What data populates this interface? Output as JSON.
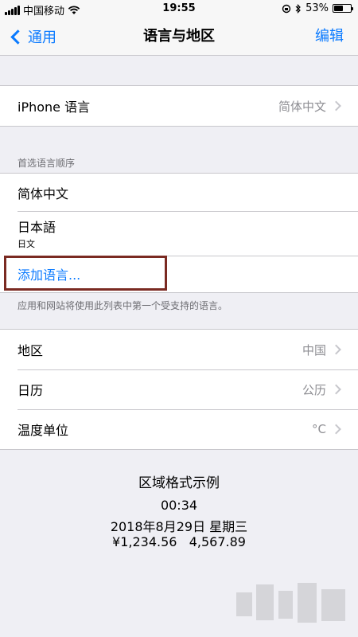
{
  "status": {
    "carrier": "中国移动",
    "time": "19:55",
    "battery_percent": "53%",
    "battery_level": 0.53
  },
  "nav": {
    "back_label": "通用",
    "title": "语言与地区",
    "edit_label": "编辑"
  },
  "iphone_language": {
    "label": "iPhone 语言",
    "value": "简体中文"
  },
  "preferred": {
    "header": "首选语言顺序",
    "languages": [
      {
        "label": "简体中文"
      },
      {
        "label": "日本語",
        "sub": "日文"
      }
    ],
    "add_label": "添加语言...",
    "footer": "应用和网站将使用此列表中第一个受支持的语言。"
  },
  "region_settings": [
    {
      "label": "地区",
      "value": "中国"
    },
    {
      "label": "日历",
      "value": "公历"
    },
    {
      "label": "温度单位",
      "value": "°C"
    }
  ],
  "format_example": {
    "title": "区域格式示例",
    "time": "00:34",
    "date": "2018年8月29日 星期三",
    "numbers": "¥1,234.56   4,567.89"
  }
}
